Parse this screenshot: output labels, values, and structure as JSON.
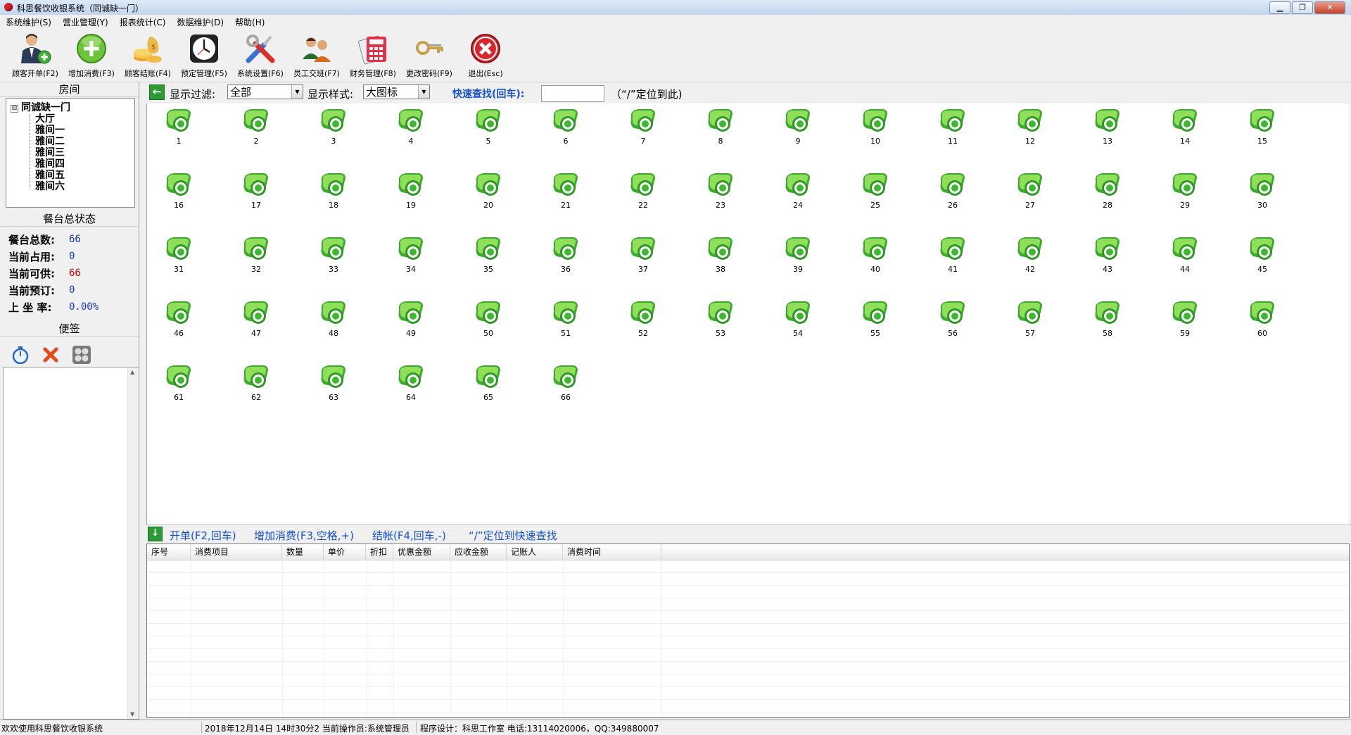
{
  "window": {
    "title": "科思餐饮收银系统（同诚缺一门）"
  },
  "menu": [
    "系统维护(S)",
    "营业管理(Y)",
    "报表统计(C)",
    "数据维护(D)",
    "帮助(H)"
  ],
  "toolbar": [
    {
      "label": "顾客开单(F2)",
      "icon": "customer-open-icon"
    },
    {
      "label": "增加消费(F3)",
      "icon": "add-consumption-icon"
    },
    {
      "label": "顾客结账(F4)",
      "icon": "checkout-icon"
    },
    {
      "label": "预定管理(F5)",
      "icon": "clock-icon"
    },
    {
      "label": "系统设置(F6)",
      "icon": "tools-icon"
    },
    {
      "label": "员工交班(F7)",
      "icon": "staff-shift-icon"
    },
    {
      "label": "财务管理(F8)",
      "icon": "calculator-icon"
    },
    {
      "label": "更改密码(F9)",
      "icon": "key-icon"
    },
    {
      "label": "退出(Esc)",
      "icon": "exit-icon"
    }
  ],
  "left": {
    "rooms_header": "房间",
    "tree": {
      "root": "同诚缺一门",
      "expander": "⊟",
      "children": [
        "大厅",
        "雅间一",
        "雅间二",
        "雅间三",
        "雅间四",
        "雅间五",
        "雅间六"
      ]
    },
    "status_header": "餐台总状态",
    "stats": [
      {
        "label": "餐台总数:",
        "value": "66",
        "color": "#1438b0"
      },
      {
        "label": "当前占用:",
        "value": "0",
        "color": "#1438b0"
      },
      {
        "label": "当前可供:",
        "value": "66",
        "color": "#d40000"
      },
      {
        "label": "当前预订:",
        "value": "0",
        "color": "#1438b0"
      },
      {
        "label": "上 坐 率:",
        "value": "0.00%",
        "color": "#1438b0"
      }
    ],
    "memo_header": "便签"
  },
  "filter": {
    "display_filter_label": "显示过滤:",
    "display_filter_value": "全部",
    "display_style_label": "显示样式:",
    "display_style_value": "大图标",
    "quick_search_label": "快速查找(回车):",
    "quick_search_value": "",
    "hint": "（“/”定位到此)"
  },
  "tables": [
    "1",
    "2",
    "3",
    "4",
    "5",
    "6",
    "7",
    "8",
    "9",
    "10",
    "11",
    "12",
    "13",
    "14",
    "15",
    "16",
    "17",
    "18",
    "19",
    "20",
    "21",
    "22",
    "23",
    "24",
    "25",
    "26",
    "27",
    "28",
    "29",
    "30",
    "31",
    "32",
    "33",
    "34",
    "35",
    "36",
    "37",
    "38",
    "39",
    "40",
    "41",
    "42",
    "43",
    "44",
    "45",
    "46",
    "47",
    "48",
    "49",
    "50",
    "51",
    "52",
    "53",
    "54",
    "55",
    "56",
    "57",
    "58",
    "59",
    "60",
    "61",
    "62",
    "63",
    "64",
    "65",
    "66"
  ],
  "actions": [
    "开单(F2,回车)",
    "增加消费(F3,空格,+)",
    "结帐(F4,回车,-)",
    "“/”定位到快速查找"
  ],
  "grid": {
    "columns": [
      "序号",
      "消费项目",
      "数量",
      "单价",
      "折扣",
      "优惠金额",
      "应收金额",
      "记账人",
      "消费时间"
    ]
  },
  "statusbar": {
    "welcome": "欢欢使用科思餐饮收银系统",
    "datetime_operator": "2018年12月14日 14时30分2 当前操作员:系统管理员",
    "designer": "程序设计：科思工作室 电话:13114020006，QQ:349880007"
  },
  "colors": {
    "accent_blue": "#1450d8",
    "available_green": "#4cc23a",
    "alert_red": "#d40000"
  }
}
